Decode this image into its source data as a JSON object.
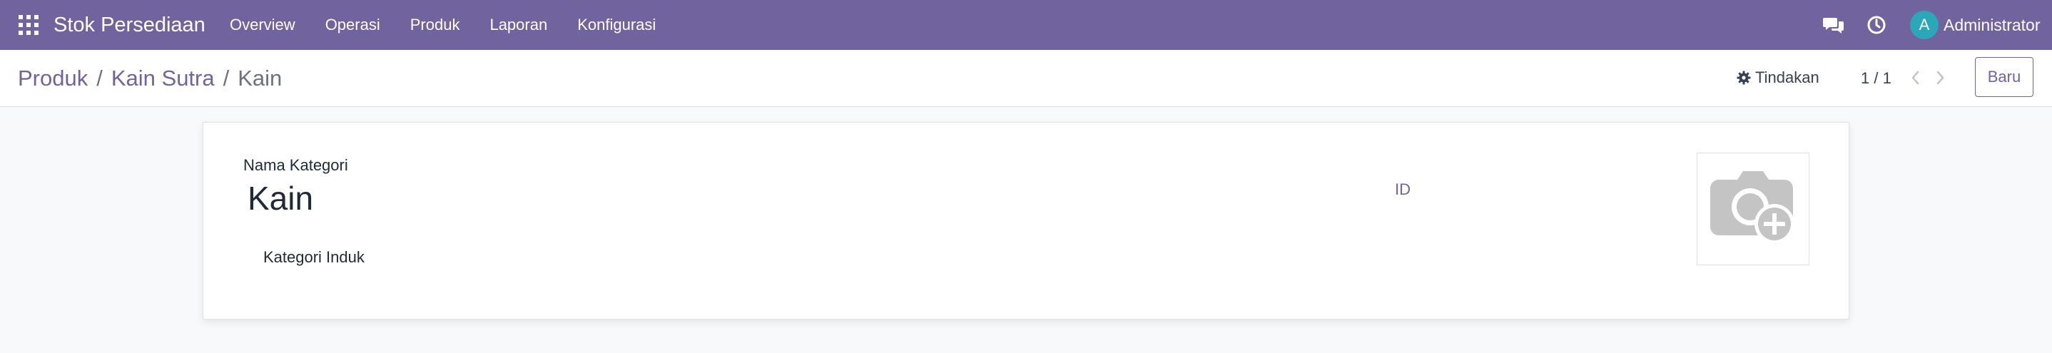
{
  "navbar": {
    "app_title": "Stok Persediaan",
    "menu": [
      {
        "label": "Overview"
      },
      {
        "label": "Operasi"
      },
      {
        "label": "Produk"
      },
      {
        "label": "Laporan"
      },
      {
        "label": "Konfigurasi"
      }
    ],
    "user": {
      "avatar_letter": "A",
      "name": "Administrator"
    },
    "icons": [
      "apps-grid-icon",
      "chat-icon",
      "clock-icon"
    ],
    "background_color": "#71639e"
  },
  "breadcrumb": {
    "items": [
      "Produk",
      "Kain Sutra",
      "Kain"
    ],
    "separator": "/"
  },
  "control_panel": {
    "actions_label": "Tindakan",
    "pager_value": "1 / 1",
    "new_label": "Baru"
  },
  "form": {
    "name_label": "Nama Kategori",
    "name_value": "Kain",
    "parent_label": "Kategori Induk",
    "parent_value": "",
    "id_label": "ID",
    "image_icon": "camera-plus-icon"
  },
  "colors": {
    "accent": "#71639e",
    "avatar": "#2aa7b8"
  }
}
